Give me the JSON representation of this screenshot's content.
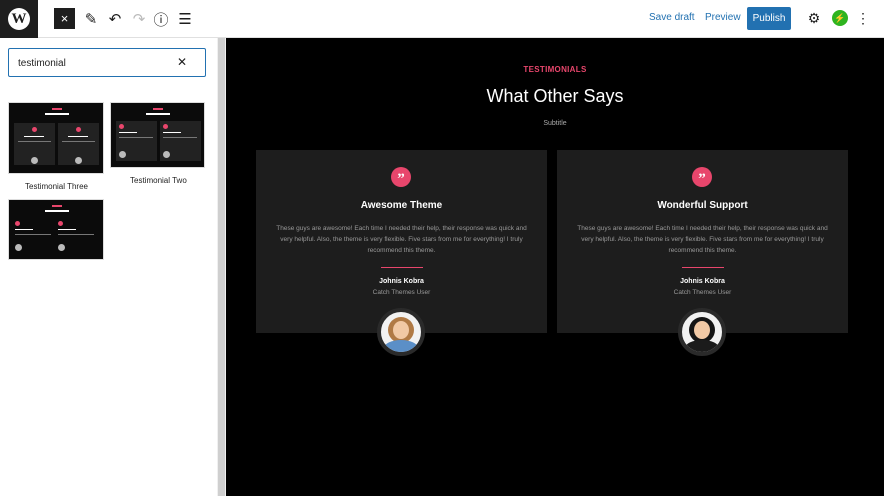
{
  "toolbar": {
    "logo_letter": "W",
    "close_icon": "×",
    "pen_icon": "✎",
    "undo_icon": "↶",
    "redo_icon": "↷",
    "info_icon": "ⓘ",
    "list_icon": "☰",
    "save_draft": "Save draft",
    "preview": "Preview",
    "publish": "Publish",
    "gear_icon": "⚙",
    "jetpack_icon": "⚡",
    "kebab_icon": "⋮"
  },
  "sidebar": {
    "search_value": "testimonial",
    "clear_icon": "✕",
    "patterns": [
      {
        "label": "Testimonial Three"
      },
      {
        "label": "Testimonial Two"
      },
      {
        "label": ""
      }
    ]
  },
  "canvas": {
    "kicker": "TESTIMONIALS",
    "headline": "What Other Says",
    "subtitle": "Subtitle",
    "quote_icon": "”",
    "cards": [
      {
        "title": "Awesome Theme",
        "body": "These guys are awesome! Each time I needed their help, their response was quick and very helpful. Also, the theme is very flexible. Five stars from me for everything! I truly recommend this theme.",
        "name": "Johnis Kobra",
        "role": "Catch Themes User"
      },
      {
        "title": "Wonderful Support",
        "body": "These guys are awesome! Each time I needed their help, their response was quick and very helpful. Also, the theme is very flexible. Five stars from me for everything! I truly recommend this theme.",
        "name": "Johnis Kobra",
        "role": "Catch Themes User"
      }
    ]
  },
  "colors": {
    "accent": "#2271b1",
    "brand_pink": "#e8466c",
    "canvas_bg": "#000000",
    "card_bg": "#1d1d1d",
    "jetpack_green": "#2fb41f"
  }
}
